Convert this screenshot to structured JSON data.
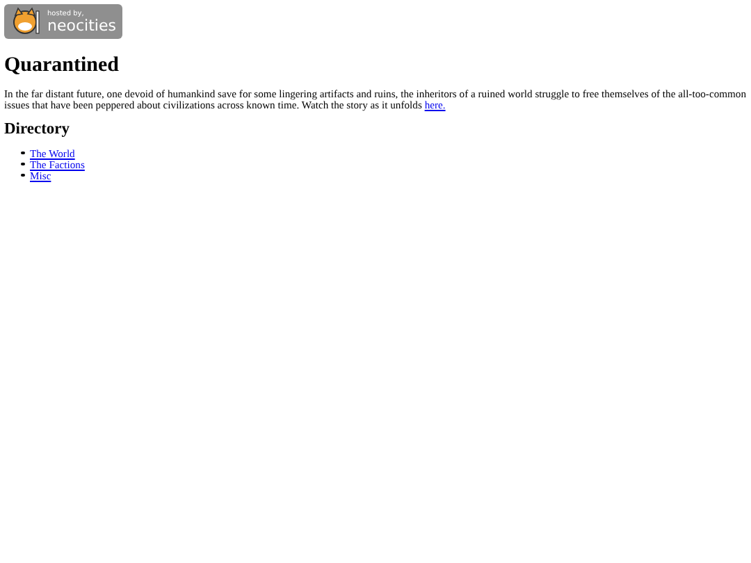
{
  "badge": {
    "small": "hosted by,",
    "big": "neocities"
  },
  "title": "Quarantined",
  "intro": {
    "text": "In the far distant future, one devoid of humankind save for some lingering artifacts and ruins, the inheritors of a ruined world struggle to free themselves of the all-too-common issues that have been peppered about civilizations across known time. Watch the story as it unfolds",
    "link": "here."
  },
  "directory": {
    "heading": "Directory",
    "items": [
      "The World",
      "The Factions",
      "Misc"
    ]
  }
}
